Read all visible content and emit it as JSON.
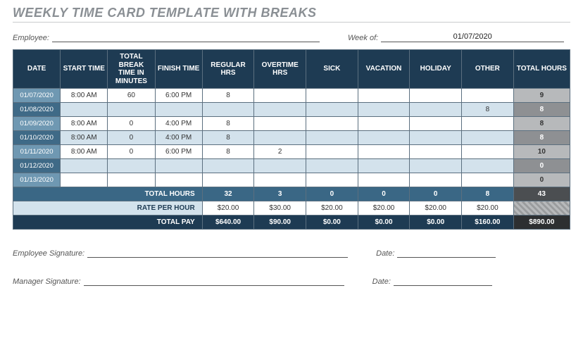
{
  "title": "WEEKLY TIME CARD TEMPLATE WITH BREAKS",
  "meta": {
    "employee_label": "Employee:",
    "employee_value": "",
    "week_of_label": "Week of:",
    "week_of_value": "01/07/2020"
  },
  "headers": {
    "date": "DATE",
    "start": "START TIME",
    "break": "TOTAL BREAK TIME IN MINUTES",
    "finish": "FINISH TIME",
    "regular": "REGULAR HRS",
    "overtime": "OVERTIME HRS",
    "sick": "SICK",
    "vacation": "VACATION",
    "holiday": "HOLIDAY",
    "other": "OTHER",
    "total": "TOTAL HOURS"
  },
  "rows": [
    {
      "date": "01/07/2020",
      "start": "8:00 AM",
      "break": "60",
      "finish": "6:00 PM",
      "regular": "8",
      "overtime": "",
      "sick": "",
      "vacation": "",
      "holiday": "",
      "other": "",
      "total": "9"
    },
    {
      "date": "01/08/2020",
      "start": "",
      "break": "",
      "finish": "",
      "regular": "",
      "overtime": "",
      "sick": "",
      "vacation": "",
      "holiday": "",
      "other": "8",
      "total": "8"
    },
    {
      "date": "01/09/2020",
      "start": "8:00 AM",
      "break": "0",
      "finish": "4:00 PM",
      "regular": "8",
      "overtime": "",
      "sick": "",
      "vacation": "",
      "holiday": "",
      "other": "",
      "total": "8"
    },
    {
      "date": "01/10/2020",
      "start": "8:00 AM",
      "break": "0",
      "finish": "4:00 PM",
      "regular": "8",
      "overtime": "",
      "sick": "",
      "vacation": "",
      "holiday": "",
      "other": "",
      "total": "8"
    },
    {
      "date": "01/11/2020",
      "start": "8:00 AM",
      "break": "0",
      "finish": "6:00 PM",
      "regular": "8",
      "overtime": "2",
      "sick": "",
      "vacation": "",
      "holiday": "",
      "other": "",
      "total": "10"
    },
    {
      "date": "01/12/2020",
      "start": "",
      "break": "",
      "finish": "",
      "regular": "",
      "overtime": "",
      "sick": "",
      "vacation": "",
      "holiday": "",
      "other": "",
      "total": "0"
    },
    {
      "date": "01/13/2020",
      "start": "",
      "break": "",
      "finish": "",
      "regular": "",
      "overtime": "",
      "sick": "",
      "vacation": "",
      "holiday": "",
      "other": "",
      "total": "0"
    }
  ],
  "summary": {
    "total_hours_label": "TOTAL HOURS",
    "total_hours": {
      "regular": "32",
      "overtime": "3",
      "sick": "0",
      "vacation": "0",
      "holiday": "0",
      "other": "8",
      "grand": "43"
    },
    "rate_label": "RATE PER HOUR",
    "rate": {
      "regular": "$20.00",
      "overtime": "$30.00",
      "sick": "$20.00",
      "vacation": "$20.00",
      "holiday": "$20.00",
      "other": "$20.00"
    },
    "pay_label": "TOTAL PAY",
    "pay": {
      "regular": "$640.00",
      "overtime": "$90.00",
      "sick": "$0.00",
      "vacation": "$0.00",
      "holiday": "$0.00",
      "other": "$160.00",
      "grand": "$890.00"
    }
  },
  "signatures": {
    "emp_sig_label": "Employee Signature:",
    "mgr_sig_label": "Manager Signature:",
    "date_label": "Date:"
  },
  "chart_data": {
    "type": "table",
    "title": "Weekly Time Card Template With Breaks",
    "week_of": "01/07/2020",
    "columns": [
      "DATE",
      "START TIME",
      "TOTAL BREAK TIME IN MINUTES",
      "FINISH TIME",
      "REGULAR HRS",
      "OVERTIME HRS",
      "SICK",
      "VACATION",
      "HOLIDAY",
      "OTHER",
      "TOTAL HOURS"
    ],
    "rows": [
      [
        "01/07/2020",
        "8:00 AM",
        60,
        "6:00 PM",
        8,
        null,
        null,
        null,
        null,
        null,
        9
      ],
      [
        "01/08/2020",
        null,
        null,
        null,
        null,
        null,
        null,
        null,
        null,
        8,
        8
      ],
      [
        "01/09/2020",
        "8:00 AM",
        0,
        "4:00 PM",
        8,
        null,
        null,
        null,
        null,
        null,
        8
      ],
      [
        "01/10/2020",
        "8:00 AM",
        0,
        "4:00 PM",
        8,
        null,
        null,
        null,
        null,
        null,
        8
      ],
      [
        "01/11/2020",
        "8:00 AM",
        0,
        "6:00 PM",
        8,
        2,
        null,
        null,
        null,
        null,
        10
      ],
      [
        "01/12/2020",
        null,
        null,
        null,
        null,
        null,
        null,
        null,
        null,
        null,
        0
      ],
      [
        "01/13/2020",
        null,
        null,
        null,
        null,
        null,
        null,
        null,
        null,
        null,
        0
      ]
    ],
    "totals": {
      "regular": 32,
      "overtime": 3,
      "sick": 0,
      "vacation": 0,
      "holiday": 0,
      "other": 8,
      "grand": 43
    },
    "rate_per_hour": {
      "regular": 20.0,
      "overtime": 30.0,
      "sick": 20.0,
      "vacation": 20.0,
      "holiday": 20.0,
      "other": 20.0
    },
    "total_pay": {
      "regular": 640.0,
      "overtime": 90.0,
      "sick": 0.0,
      "vacation": 0.0,
      "holiday": 0.0,
      "other": 160.0,
      "grand": 890.0
    }
  }
}
